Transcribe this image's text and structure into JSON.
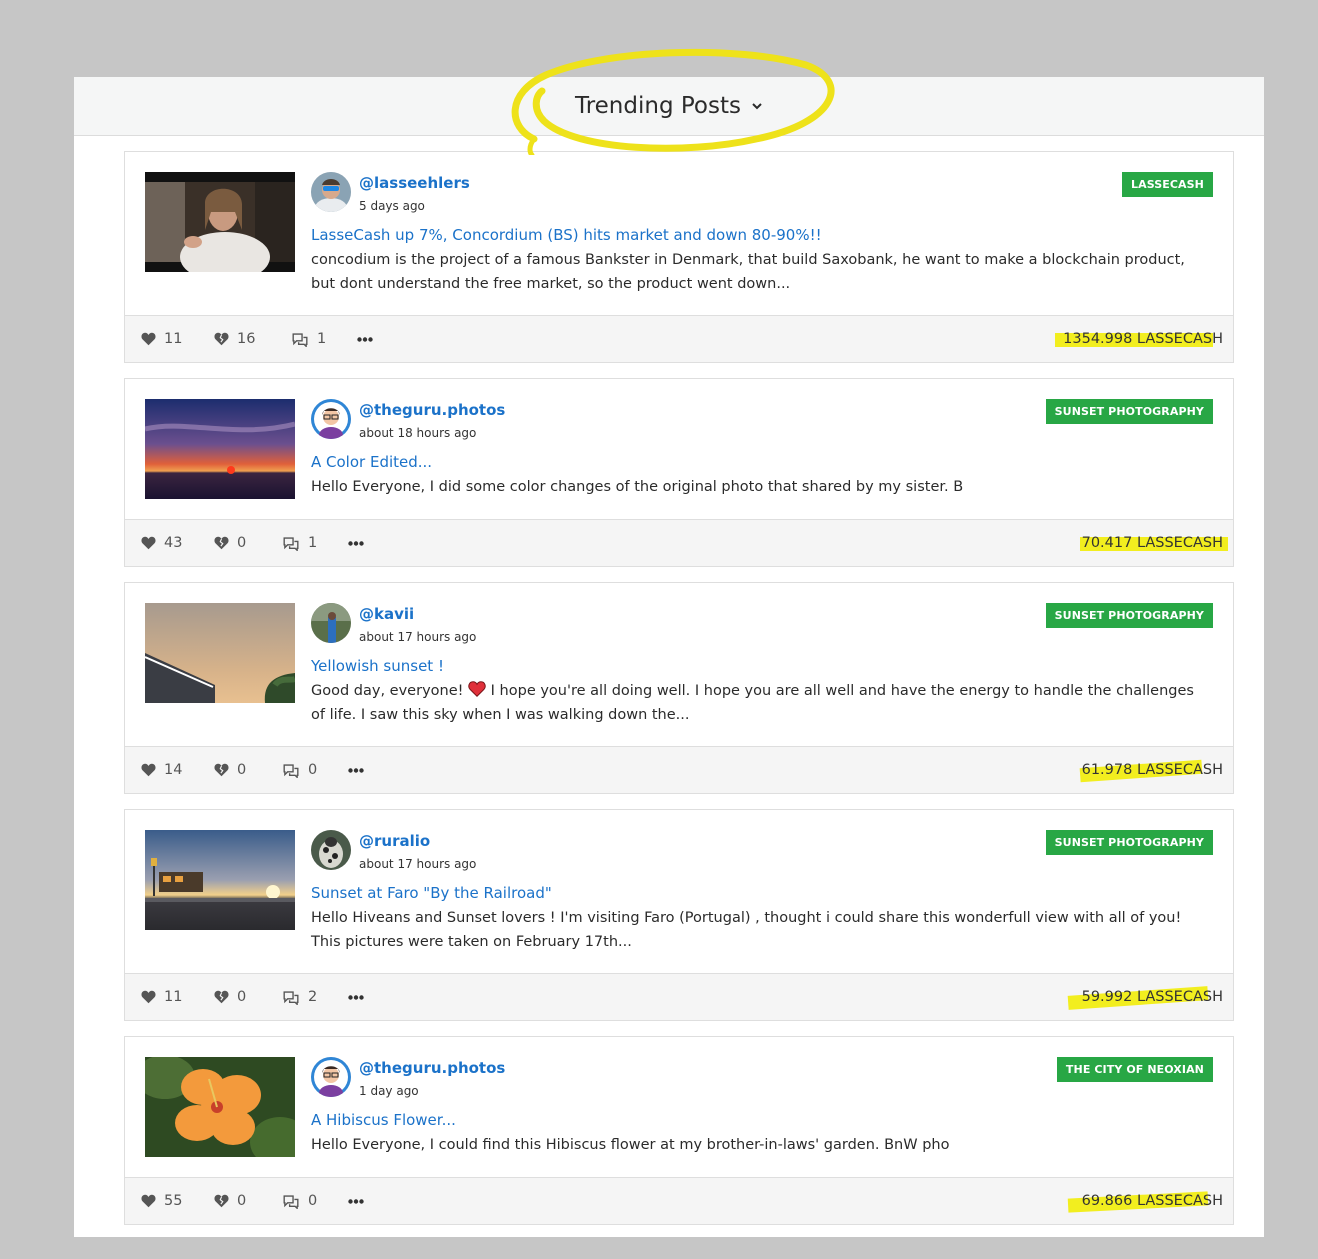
{
  "header": {
    "title": "Trending Posts"
  },
  "posts": [
    {
      "author": "@lasseehlers",
      "time": "5 days ago",
      "tag": "LASSECASH",
      "title": "LasseCash up 7%, Concordium (BS) hits market and down 80-90%!!",
      "excerpt": "concodium is the project of a famous Bankster in Denmark, that build Saxobank, he want to make a blockchain product, but dont understand the free market, so the product went down...",
      "likes": "11",
      "dislikes": "16",
      "comments": "1",
      "payout": "1354.998 LASSECASH"
    },
    {
      "author": "@theguru.photos",
      "time": "about 18 hours ago",
      "tag": "SUNSET PHOTOGRAPHY",
      "title": "A Color Edited...",
      "excerpt": "Hello Everyone, I did some color changes of the original photo that shared by my sister. B",
      "likes": "43",
      "dislikes": "0",
      "comments": "1",
      "payout": "70.417 LASSECASH"
    },
    {
      "author": "@kavii",
      "time": "about 17 hours ago",
      "tag": "SUNSET PHOTOGRAPHY",
      "title": "Yellowish sunset !",
      "excerpt_a": "Good day, everyone!",
      "excerpt_b": "I hope you're all doing well. I hope you are all well and have the energy to handle the challenges of life. I saw this sky when I was walking down the...",
      "likes": "14",
      "dislikes": "0",
      "comments": "0",
      "payout": "61.978 LASSECASH"
    },
    {
      "author": "@ruralio",
      "time": "about 17 hours ago",
      "tag": "SUNSET PHOTOGRAPHY",
      "title": "Sunset at Faro \"By the Railroad\"",
      "excerpt": "Hello Hiveans and Sunset lovers ! I'm visiting Faro (Portugal) , thought i could share this wonderfull view with all of you! This pictures were taken on February 17th...",
      "likes": "11",
      "dislikes": "0",
      "comments": "2",
      "payout": "59.992 LASSECASH"
    },
    {
      "author": "@theguru.photos",
      "time": "1 day ago",
      "tag": "THE CITY OF NEOXIAN",
      "title": "A Hibiscus Flower...",
      "excerpt": "Hello Everyone, I could find this Hibiscus flower at my brother-in-laws' garden. BnW pho",
      "likes": "55",
      "dislikes": "0",
      "comments": "0",
      "payout": "69.866 LASSECASH"
    }
  ],
  "colors": {
    "link": "#1b72c9",
    "tag_bg": "#28a745",
    "highlight": "#f2ee1f",
    "page_bg": "#c6c6c6"
  },
  "icons": [
    "chevron-down-icon",
    "heart-icon",
    "broken-heart-icon",
    "comments-icon",
    "more-icon"
  ]
}
